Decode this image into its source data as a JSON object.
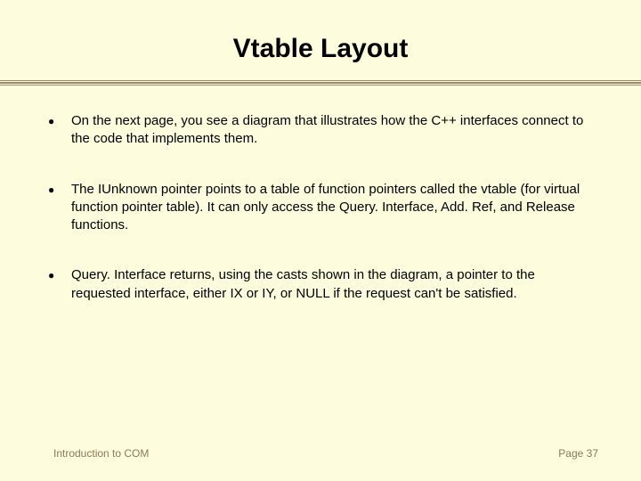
{
  "title": "Vtable Layout",
  "bullets": [
    "On the next page, you see a diagram that illustrates how the C++ interfaces connect to the code that implements them.",
    "The IUnknown pointer points to a table of function pointers called the vtable (for virtual function pointer table).  It can only access the Query. Interface, Add. Ref, and Release functions.",
    "Query. Interface returns, using the casts shown in the diagram, a pointer to the requested interface, either IX or IY, or NULL if the request can't be satisfied."
  ],
  "footer": {
    "left": "Introduction to COM",
    "right": "Page 37"
  }
}
